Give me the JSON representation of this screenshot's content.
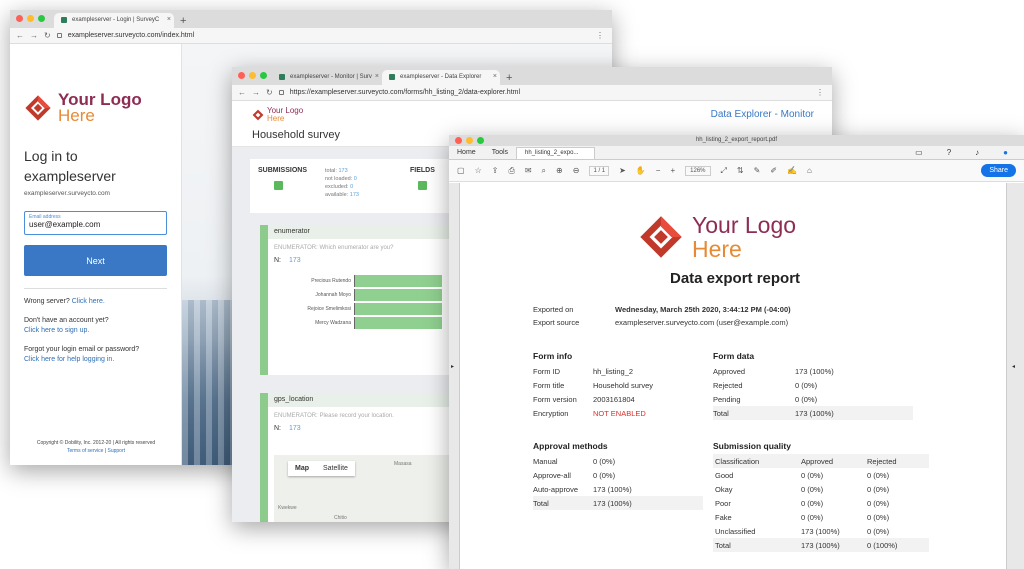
{
  "login_window": {
    "tab_title": "exampleserver - Login | SurveyC",
    "url": "exampleserver.surveycto.com/index.html",
    "logo_line1": "Your Logo",
    "logo_line2": "Here",
    "heading_line1": "Log in to",
    "heading_line2": "exampleserver",
    "server_address": "exampleserver.surveycto.com",
    "email_label": "Email address",
    "email_value": "user@example.com",
    "next_label": "Next",
    "wrong_server_text": "Wrong server?",
    "wrong_server_link": "Click here.",
    "no_account_text": "Don't have an account yet?",
    "no_account_link": "Click here to sign up.",
    "forgot_text": "Forgot your login email or password?",
    "forgot_link": "Click here for help logging in.",
    "copyright": "Copyright © Dobility, Inc. 2012-20 | All rights reserved",
    "terms_link": "Terms of service",
    "support_link": "Support"
  },
  "monitor_window": {
    "tab1_title": "exampleserver - Monitor | Surv",
    "tab2_title": "exampleserver - Data Explorer",
    "url": "https://exampleserver.surveycto.com/forms/hh_listing_2/data-explorer.html",
    "logo_line1": "Your Logo",
    "logo_line2": "Here",
    "breadcrumb": "Data Explorer - Monitor",
    "survey_title": "Household survey",
    "submissions_label": "SUBMISSIONS",
    "stats": [
      {
        "label": "total:",
        "value": "173"
      },
      {
        "label": "not loaded:",
        "value": "0"
      },
      {
        "label": "excluded:",
        "value": "0"
      },
      {
        "label": "available:",
        "value": "173"
      }
    ],
    "fields_label": "FIELDS",
    "enumerator_panel": {
      "name": "enumerator",
      "question": "ENUMERATOR: Which enumerator are you?",
      "n_label": "N:",
      "n_value": "173",
      "bars": [
        {
          "name": "Precious Rutendo",
          "value": 1.0
        },
        {
          "name": "Johannah Moyo",
          "value": 1.0
        },
        {
          "name": "Rejoice Smelimkosi",
          "value": 1.0
        },
        {
          "name": "Mercy Wadzana",
          "value": 1.0
        }
      ]
    },
    "gps_panel": {
      "name": "gps_location",
      "question": "ENUMERATOR: Please record your location.",
      "n_label": "N:",
      "n_value": "173",
      "map_tab": "Map",
      "satellite_tab": "Satellite",
      "place1": "Masasa",
      "place2": "Kwekwe",
      "place3": "Chitio"
    }
  },
  "pdf_window": {
    "window_title": "hh_listing_2_export_report.pdf",
    "menu_home": "Home",
    "menu_tools": "Tools",
    "doc_tab": "hh_listing_2_expo...",
    "page_current": "1",
    "page_total": "/ 1",
    "zoom": "126%",
    "share_label": "Share",
    "logo_line1": "Your Logo",
    "logo_line2": "Here",
    "report_title": "Data export report",
    "exported_on_label": "Exported on",
    "exported_on_value": "Wednesday, March 25th 2020, 3:44:12 PM (-04:00)",
    "export_source_label": "Export source",
    "export_source_value": "exampleserver.surveycto.com (user@example.com)",
    "form_info": {
      "title": "Form info",
      "rows": [
        {
          "k": "Form ID",
          "v": "hh_listing_2"
        },
        {
          "k": "Form title",
          "v": "Household survey"
        },
        {
          "k": "Form version",
          "v": "2003161804"
        },
        {
          "k": "Encryption",
          "v": "NOT ENABLED"
        }
      ]
    },
    "form_data": {
      "title": "Form data",
      "rows": [
        {
          "k": "Approved",
          "v": "173 (100%)"
        },
        {
          "k": "Rejected",
          "v": "0 (0%)"
        },
        {
          "k": "Pending",
          "v": "0 (0%)"
        },
        {
          "k": "Total",
          "v": "173 (100%)"
        }
      ]
    },
    "approval_methods": {
      "title": "Approval methods",
      "rows": [
        {
          "k": "Manual",
          "v": "0 (0%)"
        },
        {
          "k": "Approve-all",
          "v": "0 (0%)"
        },
        {
          "k": "Auto-approve",
          "v": "173 (100%)"
        },
        {
          "k": "Total",
          "v": "173 (100%)"
        }
      ]
    },
    "submission_quality": {
      "title": "Submission quality",
      "headers": [
        "Classification",
        "Approved",
        "Rejected"
      ],
      "rows": [
        [
          "Good",
          "0 (0%)",
          "0 (0%)"
        ],
        [
          "Okay",
          "0 (0%)",
          "0 (0%)"
        ],
        [
          "Poor",
          "0 (0%)",
          "0 (0%)"
        ],
        [
          "Fake",
          "0 (0%)",
          "0 (0%)"
        ],
        [
          "Unclassified",
          "173 (100%)",
          "0 (0%)"
        ],
        [
          "Total",
          "173 (100%)",
          "0 (100%)"
        ]
      ]
    }
  },
  "colors": {
    "logo_red": "#8e2c54",
    "logo_orange": "#e78a36",
    "link_blue": "#2f6fb6",
    "button_blue": "#3a78c5",
    "bar_green": "#8fcf8f",
    "alert_red": "#d9302c"
  }
}
